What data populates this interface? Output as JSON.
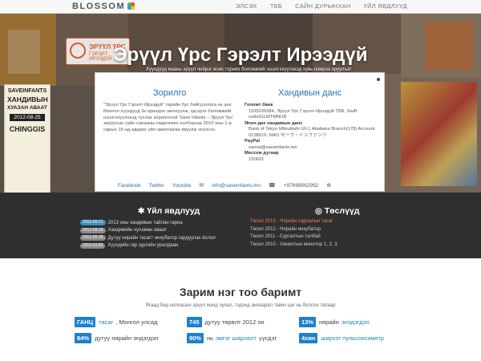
{
  "header": {
    "brand": "BLOSSOM",
    "nav": [
      "ЭЛСЭХ",
      "ТББ",
      "САЙН ДУРЫНХАН",
      "ҮЙЛ ЯВДЛУУД"
    ]
  },
  "hero": {
    "logo_line1": "ЭРҮҮЛ ҮРС",
    "logo_line2": "ГЭРЭЛТ ИРЭЭДҮЙ",
    "title": "Эрүүл Үрс Гэрэлт Ирээдүй",
    "subtitle": "Хүүхдүүд маань эрүүл чийрэг өсөх торних боломжийг нээлгэхүүлэхэд хувь нэмрээ оруулъя!",
    "poster": {
      "line1": "SAVEINFANTS",
      "line2": "ХАНДИВЫН",
      "line3": "ХУАЗАН АВААТ",
      "date": "2012-08-25",
      "line5": "CHINGGIS"
    }
  },
  "panel": {
    "left_heading": "Зорилго",
    "left_text": "\"Эрүүл Үрс Гэрэлт Ирээдүй\" төрийн бус байгууллага нь анх Монгол хүүхдүүд 3к орондоо эмчлүүлж, эдгэрэх боломжийг нээлгэхүүлэхэд туслах зорилготой 'Save Infants – Эрүүл Үрс' залуусын сайн санааны хөдөлгөөн хэлбэрээр 2010 оны 1-р сарын 15-нд өдөрөс үйл ажиллагаа явуулж эхэлсэн.",
    "right_heading": "Хандивын данс",
    "bank_label": "Голомт банк",
    "bank_value": "1105039384, Эрүүл Үрс Гэрэлт Ирээдүй ТББ, Swift code/GLMTMNUB",
    "jp_label": "Япон дах хандивын данс",
    "jp_value": "Bank of Tokyo Mitsubishi UFJ, Akabane Branch(178) Account 0138516, NAO セーブ・インファンツ",
    "paypal_label": "PayPal",
    "paypal_value": "sarnai@saveinfants.mn",
    "msg_label": "Мессеж дугаар",
    "msg_value": "150601",
    "links": {
      "facebook": "Facebook",
      "twitter": "Twitter",
      "youtube": "Youtube",
      "email": "info@saveinfants.mn",
      "phone": "+97699062992"
    }
  },
  "news": {
    "heading": "Үйл явдлууд",
    "items": [
      {
        "date": "2015-06-01",
        "title": "2013 оны хандивын тайлан гарна",
        "color": "#3d8fc2"
      },
      {
        "date": "2012-08-25",
        "title": "Хандивийн хуламан аваат",
        "color": "#8a8a8a"
      },
      {
        "date": "2012-06-28",
        "title": "Дутуу нярайн тасагт инкубатор гардуулах ёслол",
        "color": "#8a8a8a"
      },
      {
        "date": "2011-03-29",
        "title": "Хүүхдийн гар зургийн уралдаан",
        "color": "#8a8a8a"
      }
    ]
  },
  "projects": {
    "heading": "Төслүүд",
    "items": [
      {
        "title": "Төсөл 2013 - Нярайн сэдлалын тасаг",
        "color": "#e8834f"
      },
      {
        "title": "Төсөл 2012 - Нярайн инкубатор",
        "color": "#cccccc"
      },
      {
        "title": "Төсөл 2011 - Сургалтын талбай",
        "color": "#cccccc"
      },
      {
        "title": "Төсөл 2010 - Хөнөлтын монитор 1, 2, 3",
        "color": "#cccccc"
      }
    ]
  },
  "facts": {
    "heading": "Зарим нэг тоо баримт",
    "subtitle": "Ягаад бид нялхасын эрүүл мэнд чухал, тэдэнд анхаарал тавих цаг нь болсон тапаар",
    "items": [
      {
        "badge": "ГАНЦ",
        "link": "тасаг",
        "text": ", Монгол улсад"
      },
      {
        "badge": "745",
        "link": "",
        "text": "дутуу төрөлт 2012 он"
      },
      {
        "badge": "13%",
        "link": "энэдэгдэл",
        "text": "нярайн"
      },
      {
        "badge": "84%",
        "link": "",
        "text": "дутуу нярайн эндэгдэл"
      },
      {
        "badge": "90%",
        "link": "эмгэг шарлалт",
        "text": "нь"
      },
      {
        "badge": "4хөн",
        "link": "ширхэг пульсоксиметр",
        "text": ""
      }
    ],
    "accent": "#1f7fd0"
  }
}
